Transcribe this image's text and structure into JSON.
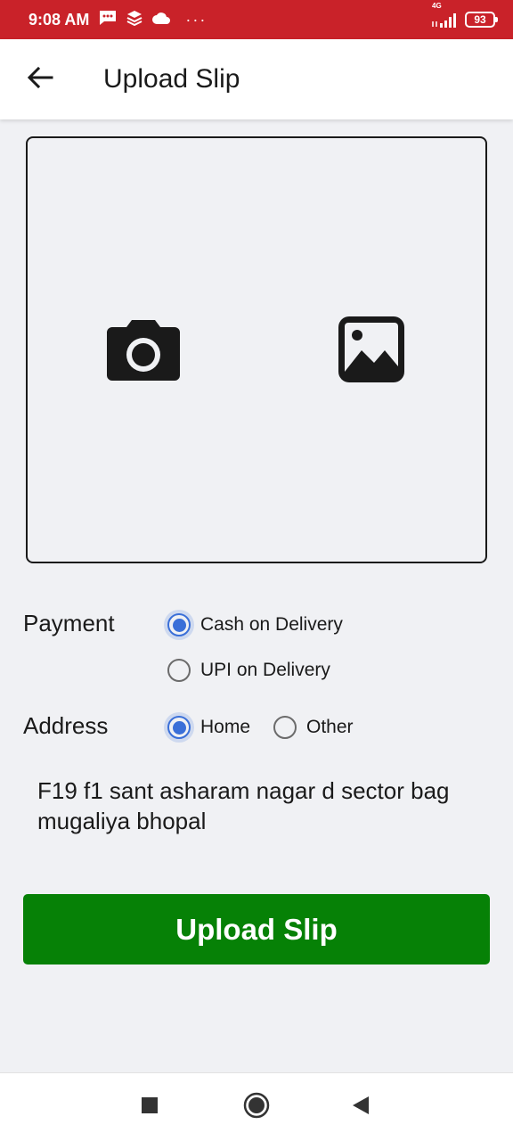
{
  "status_bar": {
    "time": "9:08 AM",
    "more": "···",
    "network_label": "4G",
    "battery_level": "93",
    "color": "#c92229"
  },
  "app_bar": {
    "title": "Upload Slip",
    "back_icon": "arrow-left-icon"
  },
  "upload_area": {
    "camera_icon": "camera-icon",
    "gallery_icon": "image-icon"
  },
  "payment": {
    "label": "Payment",
    "options": [
      {
        "label": "Cash on Delivery",
        "selected": true
      },
      {
        "label": "UPI on Delivery",
        "selected": false
      }
    ]
  },
  "address": {
    "label": "Address",
    "options": [
      {
        "label": "Home",
        "selected": true
      },
      {
        "label": "Other",
        "selected": false
      }
    ],
    "text": "F19 f1 sant asharam nagar d sector bag mugaliya bhopal"
  },
  "actions": {
    "upload_label": "Upload Slip",
    "upload_color": "#068106"
  },
  "nav_bar": {
    "recents_icon": "square-icon",
    "home_icon": "circle-home-icon",
    "back_icon": "triangle-back-icon"
  },
  "colors": {
    "accent": "#3a6fd8",
    "background": "#f0f1f4"
  }
}
